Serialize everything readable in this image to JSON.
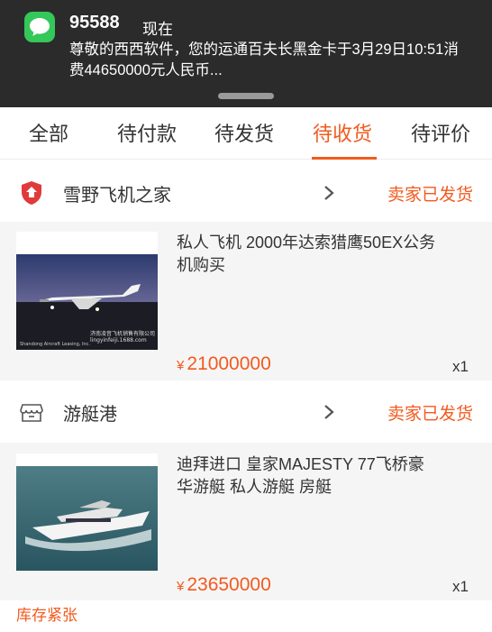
{
  "notification": {
    "sender": "95588",
    "time": "现在",
    "message": "尊敬的西西软件，您的运通百夫长黑金卡于3月29日10:51消费44650000元人民币..."
  },
  "tabs": [
    {
      "label": "全部"
    },
    {
      "label": "待付款"
    },
    {
      "label": "待发货"
    },
    {
      "label": "待收货",
      "active": true
    },
    {
      "label": "待评价"
    }
  ],
  "orders": [
    {
      "shop": {
        "name": "雪野飞机之家",
        "status": "卖家已发货",
        "icon": "shield-logo-icon"
      },
      "product": {
        "title": "私人飞机 2000年达索猎鹰50EX公务机购买",
        "price_symbol": "¥",
        "price": "21000000",
        "qty": "x1",
        "image_caption": "济南凌音飞机销售有限公司",
        "image_url_text": "lingyinfeiji.1688.com",
        "image_brand": "Shandong Aircraft Leasing, Inc."
      }
    },
    {
      "shop": {
        "name": "游艇港",
        "status": "卖家已发货",
        "icon": "store-icon"
      },
      "product": {
        "title": "迪拜进口 皇家MAJESTY 77飞桥豪华游艇 私人游艇 房艇",
        "price_symbol": "¥",
        "price": "23650000",
        "qty": "x1",
        "badge": "库存紧张"
      }
    }
  ],
  "colors": {
    "accent": "#f25a1f",
    "notification_bg": "#2b2b2b",
    "messages_green": "#34c759",
    "card_bg": "#f5f5f5"
  }
}
